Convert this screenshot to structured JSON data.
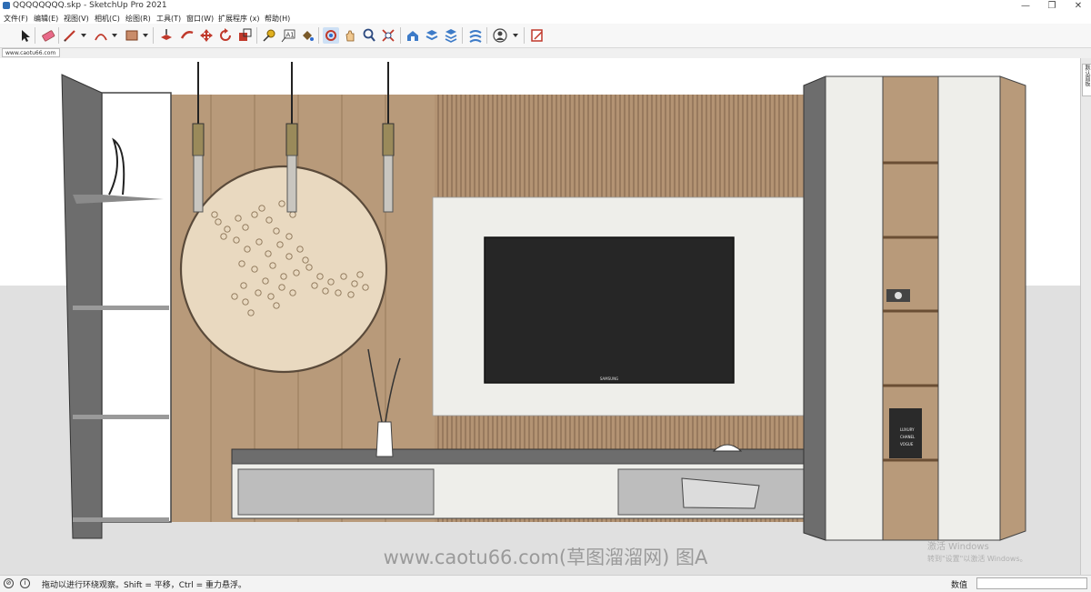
{
  "window": {
    "title": "QQQQQQQQ.skp - SketchUp Pro 2021",
    "minimize": "—",
    "maximize": "❐",
    "close": "✕"
  },
  "menu": [
    "文件(F)",
    "编辑(E)",
    "视图(V)",
    "相机(C)",
    "绘图(R)",
    "工具(T)",
    "窗口(W)",
    "扩展程序 (x)",
    "帮助(H)"
  ],
  "toolbar": {
    "tools": [
      "select-icon",
      "eraser-icon",
      "pencil-icon",
      "arc-icon",
      "rectangle-icon",
      "push-pull-icon",
      "follow-me-icon",
      "move-icon",
      "rotate-icon",
      "scale-icon",
      "tape-measure-icon",
      "text-icon",
      "paint-bucket-icon",
      "orbit-icon",
      "pan-icon",
      "zoom-icon",
      "zoom-extents-icon",
      "warehouse-icon",
      "extension-warehouse-icon",
      "layout-icon",
      "style-builder-icon",
      "profile-icon",
      "section-icon"
    ]
  },
  "scene_tab": "www.caotu66.com",
  "right_panel": {
    "tray_label": "默认面板"
  },
  "watermark": {
    "site": "www.caotu66.com(草图溜溜网) 图A",
    "activate_title": "激活 Windows",
    "activate_sub": "转到\"设置\"以激活 Windows。"
  },
  "statusbar": {
    "message": "拖动以进行环绕观察。Shift = 平移，Ctrl = 重力悬浮。",
    "value_label": "数值",
    "value": ""
  },
  "scene": {
    "tv_brand": "SAMSUNG",
    "book_titles": [
      "LUXURY",
      "CHANEL",
      "VOGUE"
    ]
  },
  "colors": {
    "wood": "#b89a7a",
    "cabinet_light": "#eeeeea",
    "cabinet_dark": "#6d6d6d",
    "tv": "#262626",
    "disc": "#e9d9c0",
    "floor": "#e0e0e0"
  }
}
